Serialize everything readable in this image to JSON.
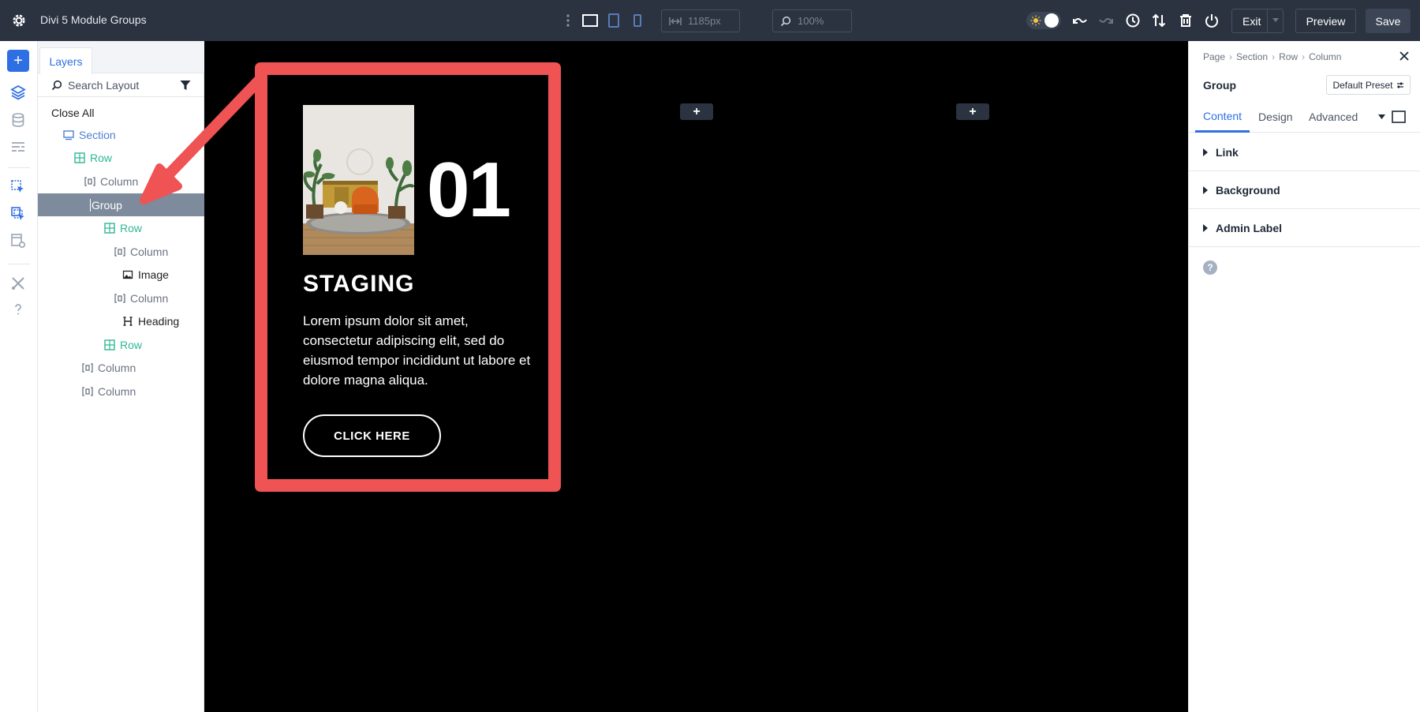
{
  "app": {
    "title": "Divi 5 Module Groups"
  },
  "toolbar": {
    "width_value": "1185px",
    "zoom_value": "100%",
    "exit_label": "Exit",
    "preview_label": "Preview",
    "save_label": "Save"
  },
  "layers": {
    "tab_label": "Layers",
    "search_placeholder": "Search Layout",
    "close_all": "Close All",
    "tree": [
      {
        "label": "Section",
        "type": "section"
      },
      {
        "label": "Row",
        "type": "row"
      },
      {
        "label": "Column",
        "type": "column"
      },
      {
        "label": "Group",
        "type": "group",
        "selected": true
      },
      {
        "label": "Row",
        "type": "row"
      },
      {
        "label": "Column",
        "type": "column"
      },
      {
        "label": "Image",
        "type": "image"
      },
      {
        "label": "Column",
        "type": "column"
      },
      {
        "label": "Heading",
        "type": "heading"
      },
      {
        "label": "Row",
        "type": "row"
      },
      {
        "label": "Column",
        "type": "column"
      },
      {
        "label": "Column",
        "type": "column"
      }
    ]
  },
  "canvas": {
    "plus_label": "+",
    "card": {
      "number": "01",
      "heading": "STAGING",
      "body": "Lorem ipsum dolor sit amet, consectetur adipiscing elit, sed do eiusmod tempor incididunt ut labore et dolore magna aliqua.",
      "button": "CLICK HERE"
    }
  },
  "settings": {
    "breadcrumbs": [
      "Page",
      "Section",
      "Row",
      "Column"
    ],
    "module_label": "Group",
    "preset_label": "Default Preset",
    "tabs": [
      "Content",
      "Design",
      "Advanced"
    ],
    "active_tab": "Content",
    "groups": [
      "Link",
      "Background",
      "Admin Label"
    ],
    "help": "?"
  },
  "colors": {
    "accent": "#2f6fe4",
    "row": "#2fb796",
    "highlight": "#ef5354",
    "topbar": "#2b3340"
  }
}
